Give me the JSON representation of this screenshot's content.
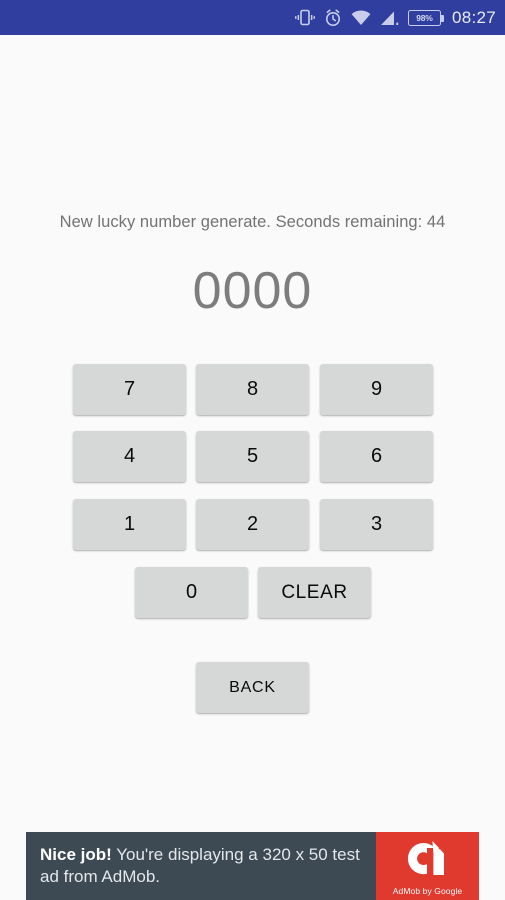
{
  "status_bar": {
    "background_color": "#303F9F",
    "clock": "08:27",
    "battery_percent": "98%",
    "icons": [
      "vibrate-icon",
      "alarm-icon",
      "wifi-icon",
      "cellular-signal-icon",
      "battery-icon"
    ]
  },
  "screen": {
    "background_color": "#FAFAFA",
    "countdown_message": "New lucky number generate. Seconds remaining: 44",
    "lucky_number": "0000"
  },
  "keypad": {
    "button_color": "#D6D7D7",
    "rows": [
      {
        "keys": [
          "7",
          "8",
          "9"
        ]
      },
      {
        "keys": [
          "4",
          "5",
          "6"
        ]
      },
      {
        "keys": [
          "1",
          "2",
          "3"
        ]
      }
    ],
    "zero_label": "0",
    "clear_label": "CLEAR",
    "back_label": "BACK"
  },
  "ad_banner": {
    "text_background_color": "#3D4A54",
    "logo_background_color": "#E0392E",
    "lead": "Nice job!",
    "body": " You're displaying a 320 x 50 test ad from AdMob.",
    "caption": "AdMob by Google"
  }
}
